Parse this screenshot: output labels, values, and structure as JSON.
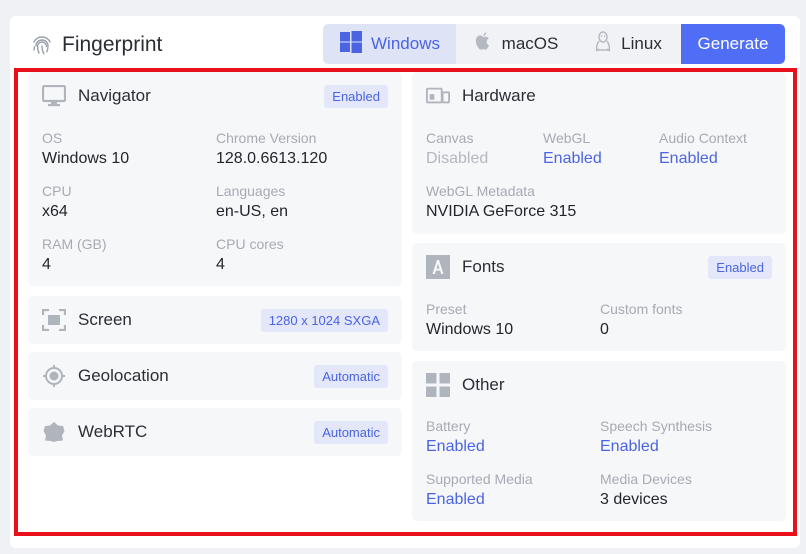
{
  "header": {
    "title": "Fingerprint"
  },
  "os_tabs": [
    {
      "label": "Windows",
      "icon": "windows-icon",
      "active": true
    },
    {
      "label": "macOS",
      "icon": "apple-icon",
      "active": false
    },
    {
      "label": "Linux",
      "icon": "linux-icon",
      "active": false
    }
  ],
  "generate_label": "Generate",
  "navigator": {
    "title": "Navigator",
    "badge": "Enabled",
    "fields": [
      {
        "label": "OS",
        "value": "Windows 10"
      },
      {
        "label": "Chrome Version",
        "value": "128.0.6613.120"
      },
      {
        "label": "CPU",
        "value": "x64"
      },
      {
        "label": "Languages",
        "value": "en-US, en"
      },
      {
        "label": "RAM (GB)",
        "value": "4"
      },
      {
        "label": "CPU cores",
        "value": "4"
      }
    ]
  },
  "screen": {
    "title": "Screen",
    "badge": "1280 x 1024 SXGA"
  },
  "geolocation": {
    "title": "Geolocation",
    "badge": "Automatic"
  },
  "webrtc": {
    "title": "WebRTC",
    "badge": "Automatic"
  },
  "hardware": {
    "title": "Hardware",
    "fields": [
      {
        "label": "Canvas",
        "value": "Disabled"
      },
      {
        "label": "WebGL",
        "value": "Enabled"
      },
      {
        "label": "Audio Context",
        "value": "Enabled"
      },
      {
        "label": "WebGL Metadata",
        "value": "NVIDIA GeForce 315"
      }
    ]
  },
  "fonts": {
    "title": "Fonts",
    "badge": "Enabled",
    "fields": [
      {
        "label": "Preset",
        "value": "Windows 10"
      },
      {
        "label": "Custom fonts",
        "value": "0"
      }
    ]
  },
  "other": {
    "title": "Other",
    "fields": [
      {
        "label": "Battery",
        "value": "Enabled"
      },
      {
        "label": "Speech Synthesis",
        "value": "Enabled"
      },
      {
        "label": "Supported Media",
        "value": "Enabled"
      },
      {
        "label": "Media Devices",
        "value": "3 devices"
      }
    ]
  },
  "colors": {
    "accent": "#4f6df5",
    "link": "#4a64e2",
    "highlight": "#e8101a"
  }
}
